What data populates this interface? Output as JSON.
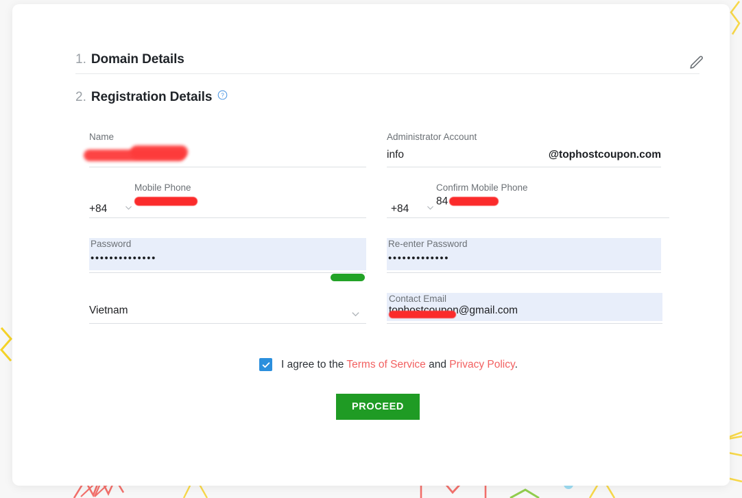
{
  "page": {
    "background_color": "#f7f7f7",
    "card_color": "#ffffff"
  },
  "sections": {
    "domain_details": {
      "number": "1.",
      "title": "Domain Details",
      "edit_icon": "pencil-icon"
    },
    "registration_details": {
      "number": "2.",
      "title": "Registration Details",
      "help_icon": "question-circle-icon"
    }
  },
  "form": {
    "name": {
      "label": "Name",
      "value": "",
      "redacted": true
    },
    "administrator_account": {
      "label": "Administrator Account",
      "value": "info",
      "domain_suffix": "@tophostcoupon.com"
    },
    "mobile_phone": {
      "label": "Mobile Phone",
      "country_code": "+84",
      "value": "",
      "redacted": true,
      "chevron_icon": "chevron-down-icon"
    },
    "confirm_mobile_phone": {
      "label": "Confirm Mobile Phone",
      "country_code": "+84",
      "value": "84",
      "redacted": true,
      "chevron_icon": "chevron-down-icon"
    },
    "password": {
      "label": "Password",
      "value": "••••••••••••••",
      "autofilled": true,
      "strength_color": "#23a327"
    },
    "reenter_password": {
      "label": "Re-enter Password",
      "value": "•••••••••••••",
      "autofilled": true
    },
    "country": {
      "value": "Vietnam",
      "chevron_icon": "chevron-down-icon"
    },
    "contact_email": {
      "label": "Contact Email",
      "value": "tophostcoupon@gmail.com",
      "redacted_part": "tophostcoupon",
      "autofilled": true
    }
  },
  "terms": {
    "checked": true,
    "check_icon": "checkmark-icon",
    "prefix": "I agree to the ",
    "terms_link": "Terms of Service",
    "conjunction": " and ",
    "privacy_link": "Privacy Policy",
    "suffix": ".",
    "link_color": "#f26060",
    "checkbox_color": "#2b8fdd"
  },
  "actions": {
    "proceed_label": "PROCEED",
    "proceed_color": "#1f9b24"
  }
}
